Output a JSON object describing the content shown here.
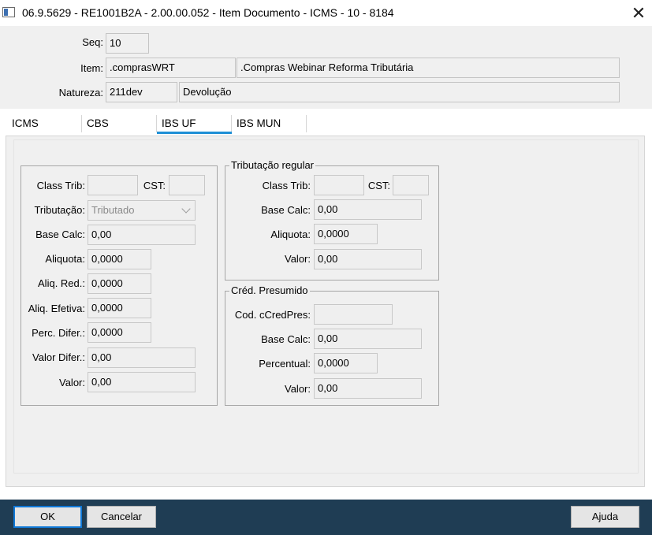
{
  "window": {
    "title": "06.9.5629 - RE1001B2A - 2.00.00.052 - Item Documento - ICMS - 10 - 8184",
    "close_glyph": "✕",
    "icon": "window-app-icon"
  },
  "header": {
    "seq_label": "Seq:",
    "seq_value": "10",
    "item_label": "Item:",
    "item_code": ".comprasWRT",
    "item_desc": ".Compras Webinar Reforma Tributária",
    "natureza_label": "Natureza:",
    "natureza_code": "211dev",
    "natureza_desc": "Devolução"
  },
  "tabs": [
    {
      "label": "ICMS",
      "active": false
    },
    {
      "label": "CBS",
      "active": false
    },
    {
      "label": "IBS UF",
      "active": true
    },
    {
      "label": "IBS MUN",
      "active": false
    }
  ],
  "left_group": {
    "class_trib_label": "Class Trib:",
    "class_trib_value": "",
    "cst_label": "CST:",
    "cst_value": "",
    "tributacao_label": "Tributação:",
    "tributacao_value": "Tributado",
    "base_calc_label": "Base Calc:",
    "base_calc_value": "0,00",
    "aliquota_label": "Aliquota:",
    "aliquota_value": "0,0000",
    "aliq_red_label": "Aliq. Red.:",
    "aliq_red_value": "0,0000",
    "aliq_efetiva_label": "Aliq. Efetiva:",
    "aliq_efetiva_value": "0,0000",
    "perc_difer_label": "Perc. Difer.:",
    "perc_difer_value": "0,0000",
    "valor_difer_label": "Valor Difer.:",
    "valor_difer_value": "0,00",
    "valor_label": "Valor:",
    "valor_value": "0,00"
  },
  "regular_group": {
    "title": "Tributação regular",
    "class_trib_label": "Class Trib:",
    "class_trib_value": "",
    "cst_label": "CST:",
    "cst_value": "",
    "base_calc_label": "Base Calc:",
    "base_calc_value": "0,00",
    "aliquota_label": "Aliquota:",
    "aliquota_value": "0,0000",
    "valor_label": "Valor:",
    "valor_value": "0,00"
  },
  "presumido_group": {
    "title": "Créd. Presumido",
    "cod_label": "Cod. cCredPres:",
    "cod_value": "",
    "base_calc_label": "Base Calc:",
    "base_calc_value": "0,00",
    "percentual_label": "Percentual:",
    "percentual_value": "0,0000",
    "valor_label": "Valor:",
    "valor_value": "0,00"
  },
  "footer": {
    "ok_label": "OK",
    "cancel_label": "Cancelar",
    "help_label": "Ajuda"
  }
}
